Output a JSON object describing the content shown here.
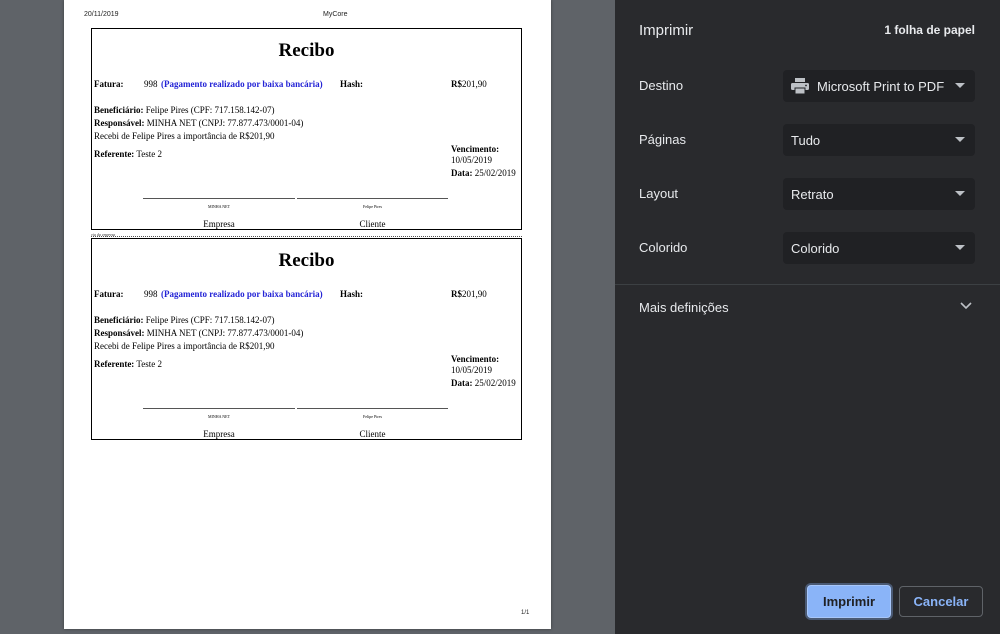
{
  "preview": {
    "header_date": "20/11/2019",
    "header_title": "MyCore",
    "cut_note": "via da empresa",
    "page_number": "1/1",
    "receipts": [
      {
        "title": "Recibo",
        "fatura_label": "Fatura:",
        "fatura_value": "998",
        "payment_note": "(Pagamento realizado por baixa bancária)",
        "hash_label": "Hash:",
        "amount_prefix": "R$",
        "amount_value": "201,90",
        "beneficiario_label": "Beneficiário:",
        "beneficiario_value": "Felipe Pires (CPF: 717.158.142-07)",
        "responsavel_label": "Responsável:",
        "responsavel_value": "MINHA NET (CNPJ: 77.877.473/0001-04)",
        "statement": "Recebi de Felipe Pires a importância de R$201,90",
        "referente_label": "Referente:",
        "referente_value": "Teste 2",
        "vencimento_label": "Vencimento:",
        "vencimento_value": "10/05/2019",
        "data_label": "Data:",
        "data_value": "25/02/2019",
        "sig_company_small": "MINHA NET",
        "sig_client_small": "Felipe Pires",
        "sig_company_caption": "Empresa",
        "sig_client_caption": "Cliente"
      },
      {
        "title": "Recibo",
        "fatura_label": "Fatura:",
        "fatura_value": "998",
        "payment_note": "(Pagamento realizado por baixa bancária)",
        "hash_label": "Hash:",
        "amount_prefix": "R$",
        "amount_value": "201,90",
        "beneficiario_label": "Beneficiário:",
        "beneficiario_value": "Felipe Pires (CPF: 717.158.142-07)",
        "responsavel_label": "Responsável:",
        "responsavel_value": "MINHA NET (CNPJ: 77.877.473/0001-04)",
        "statement": "Recebi de Felipe Pires a importância de R$201,90",
        "referente_label": "Referente:",
        "referente_value": "Teste 2",
        "vencimento_label": "Vencimento:",
        "vencimento_value": "10/05/2019",
        "data_label": "Data:",
        "data_value": "25/02/2019",
        "sig_company_small": "MINHA NET",
        "sig_client_small": "Felipe Pires",
        "sig_company_caption": "Empresa",
        "sig_client_caption": "Cliente"
      }
    ]
  },
  "panel": {
    "title": "Imprimir",
    "sheets": "1 folha de papel",
    "destino_label": "Destino",
    "destino_value": "Microsoft Print to PDF",
    "destino_icon": "printer-icon",
    "paginas_label": "Páginas",
    "paginas_value": "Tudo",
    "layout_label": "Layout",
    "layout_value": "Retrato",
    "colorido_label": "Colorido",
    "colorido_value": "Colorido",
    "more_settings": "Mais definições",
    "print_button": "Imprimir",
    "cancel_button": "Cancelar"
  },
  "colors": {
    "panel_bg": "#292a2d",
    "select_bg": "#202124",
    "accent": "#8ab4f8",
    "preview_bg": "#5f6368",
    "payment_note": "#2323d6"
  }
}
